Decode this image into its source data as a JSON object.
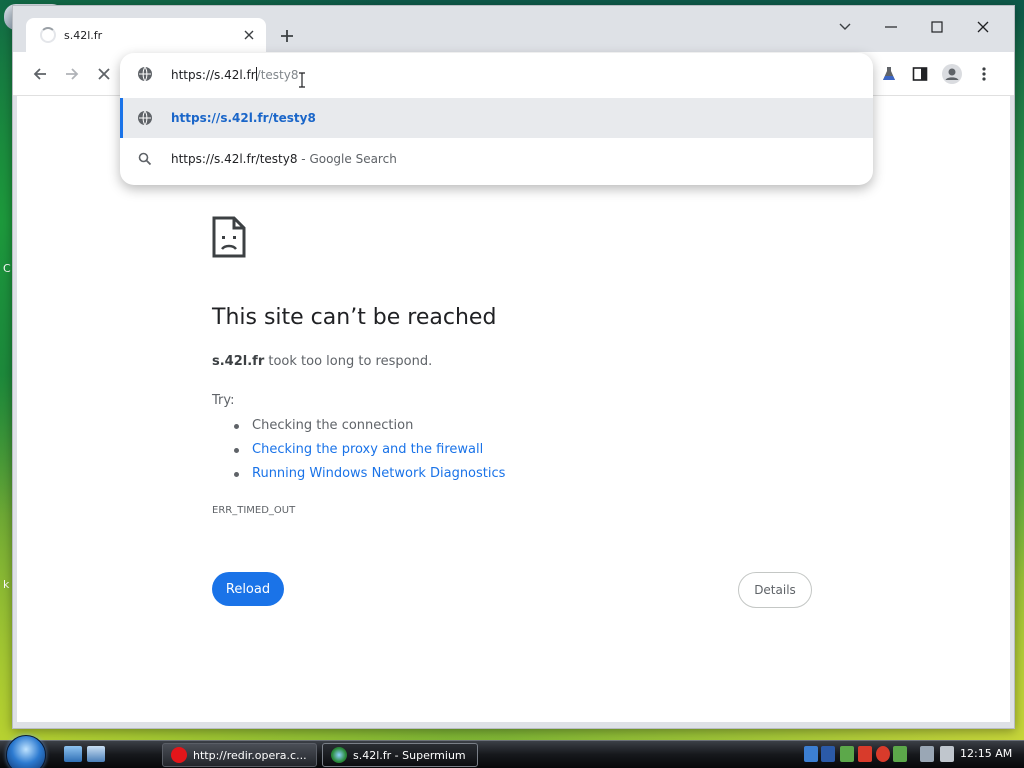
{
  "browser": {
    "tab": {
      "title": "s.42l.fr"
    },
    "omnibox": {
      "typed_text": "https://s.42l.fr",
      "typed_suffix": "/testy8",
      "suggestions": [
        {
          "text": "https://s.42l.fr/testy8",
          "suffix": ""
        },
        {
          "text": "https://s.42l.fr/testy8",
          "suffix": " - Google Search"
        }
      ]
    }
  },
  "error_page": {
    "title": "This site can’t be reached",
    "host": "s.42l.fr",
    "message": " took too long to respond.",
    "try_label": "Try:",
    "suggestions": [
      "Checking the connection",
      "Checking the proxy and the firewall",
      "Running Windows Network Diagnostics"
    ],
    "error_code": "ERR_TIMED_OUT",
    "reload_label": "Reload",
    "details_label": "Details"
  },
  "taskbar": {
    "tasks": [
      {
        "label": "http://redir.opera.c..."
      },
      {
        "label": "s.42l.fr - Supermium"
      }
    ],
    "clock": "12:15 AM"
  },
  "colors": {
    "link": "#1a73e8",
    "accent": "#1a73e8"
  },
  "icons": [
    "globe-icon",
    "search-icon",
    "back-icon",
    "forward-icon",
    "stop-icon",
    "sad-document-icon"
  ]
}
